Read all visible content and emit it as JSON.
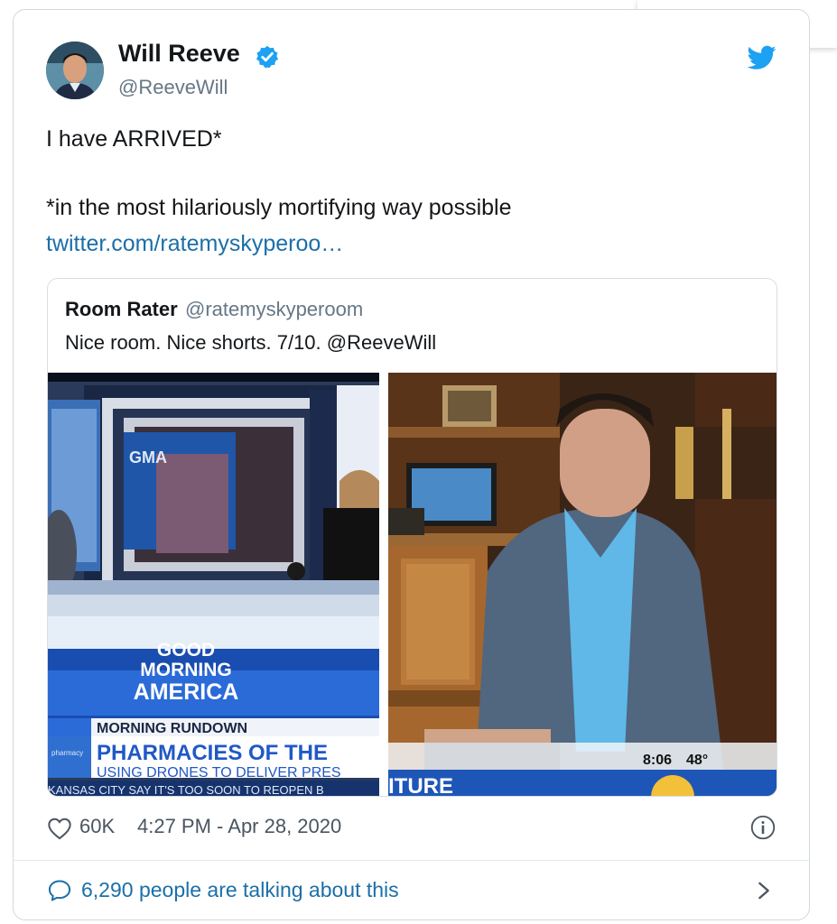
{
  "tweet": {
    "author_name": "Will Reeve",
    "author_handle": "@ReeveWill",
    "text_line1": "I have ARRIVED*",
    "text_line2": "*in the most hilariously mortifying way possible",
    "link": "twitter.com/ratemyskyperoo…",
    "likes": "60K",
    "timestamp": "4:27 PM - Apr 28, 2020",
    "talking": "6,290 people are talking about this"
  },
  "quote": {
    "author_name": "Room Rater",
    "author_handle": "@ratemyskyperoom",
    "text": "Nice room. Nice shorts. 7/10. @ReeveWill"
  },
  "left_photo": {
    "gma_logo": "GMA",
    "show_line1": "GOOD",
    "show_line2": "MORNING",
    "show_line3": "AMERICA",
    "rundown": "MORNING RUNDOWN",
    "headline": "PHARMACIES OF THE",
    "subhead": "USING DRONES TO DELIVER PRES",
    "ticker": "KANSAS CITY SAY IT'S TOO SOON TO REOPEN B",
    "tag": "pharmacy"
  },
  "right_photo": {
    "clock": "8:06",
    "temp": "48°",
    "lower_third": "ITURE"
  },
  "icons": {
    "verified": "verified-badge-icon",
    "bird": "twitter-bird-icon",
    "heart": "heart-icon",
    "info": "info-icon",
    "bubble": "comment-bubble-icon",
    "chevron": "chevron-right-icon"
  },
  "colors": {
    "link": "#1b6fa8",
    "verified": "#1da1f2",
    "handle": "#657786"
  }
}
